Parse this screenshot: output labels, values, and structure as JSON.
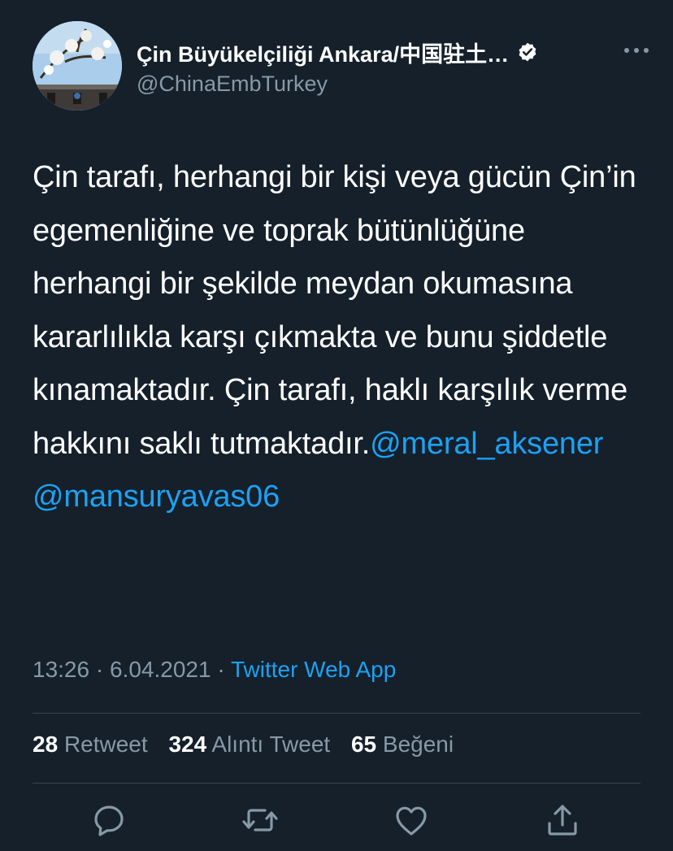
{
  "account": {
    "display_name": "Çin Büyükelçiliği Ankara/中国驻土…",
    "handle": "@ChinaEmbTurkey"
  },
  "tweet": {
    "text": "Çin tarafı, herhangi bir kişi veya gücün Çin’in egemenliğine ve toprak bütünlüğüne herhangi bir şekilde meydan okumasına kararlılıkla karşı çıkmakta ve bunu şiddetle kınamaktadır. Çin tarafı, haklı karşılık verme hakkını saklı tutmaktadır.",
    "mention_1": "@meral_aksener",
    "mention_2": "@mansuryavas06"
  },
  "meta": {
    "time": "13:26",
    "separator": "·",
    "date": "6.04.2021",
    "source": "Twitter Web App"
  },
  "stats": {
    "retweet_count": "28",
    "retweet_label": "Retweet",
    "quote_count": "324",
    "quote_label": "Alıntı Tweet",
    "like_count": "65",
    "like_label": "Beğeni"
  },
  "colors": {
    "background": "#15202b",
    "accent": "#1da1f2",
    "secondary_text": "#8899a6",
    "divider": "#38444d"
  },
  "icons": [
    "verified-badge-icon",
    "more-icon",
    "reply-icon",
    "retweet-icon",
    "like-icon",
    "share-icon"
  ]
}
